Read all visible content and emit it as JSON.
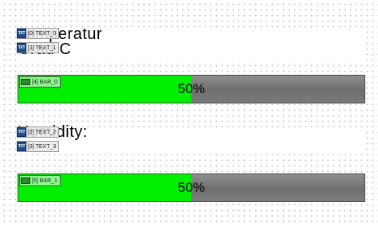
{
  "colors": {
    "bar_fill": "#00ee00",
    "bar_track": "#808080",
    "text": "#000000"
  },
  "widgets": {
    "temperature": {
      "title_tag": "[0] TEXT_0",
      "title_text": "Temperatur",
      "unit_tag": "[1] TEXT_1",
      "unit_text": "Grad C",
      "bar_tag": "[4] BAR_0",
      "bar_value": 0.5,
      "bar_label": "50%"
    },
    "humidity": {
      "title_tag": "[2] TEXT_2",
      "title_text": "Humidity:",
      "unit_tag": "[3] TEXT_3",
      "unit_text": "%",
      "bar_tag": "[5] BAR_1",
      "bar_value": 0.5,
      "bar_label": "50%"
    }
  },
  "icons": {
    "text_tag_icon": "text-widget-icon",
    "bar_tag_icon": "bar-widget-icon"
  },
  "icon_glyph": "TXT"
}
